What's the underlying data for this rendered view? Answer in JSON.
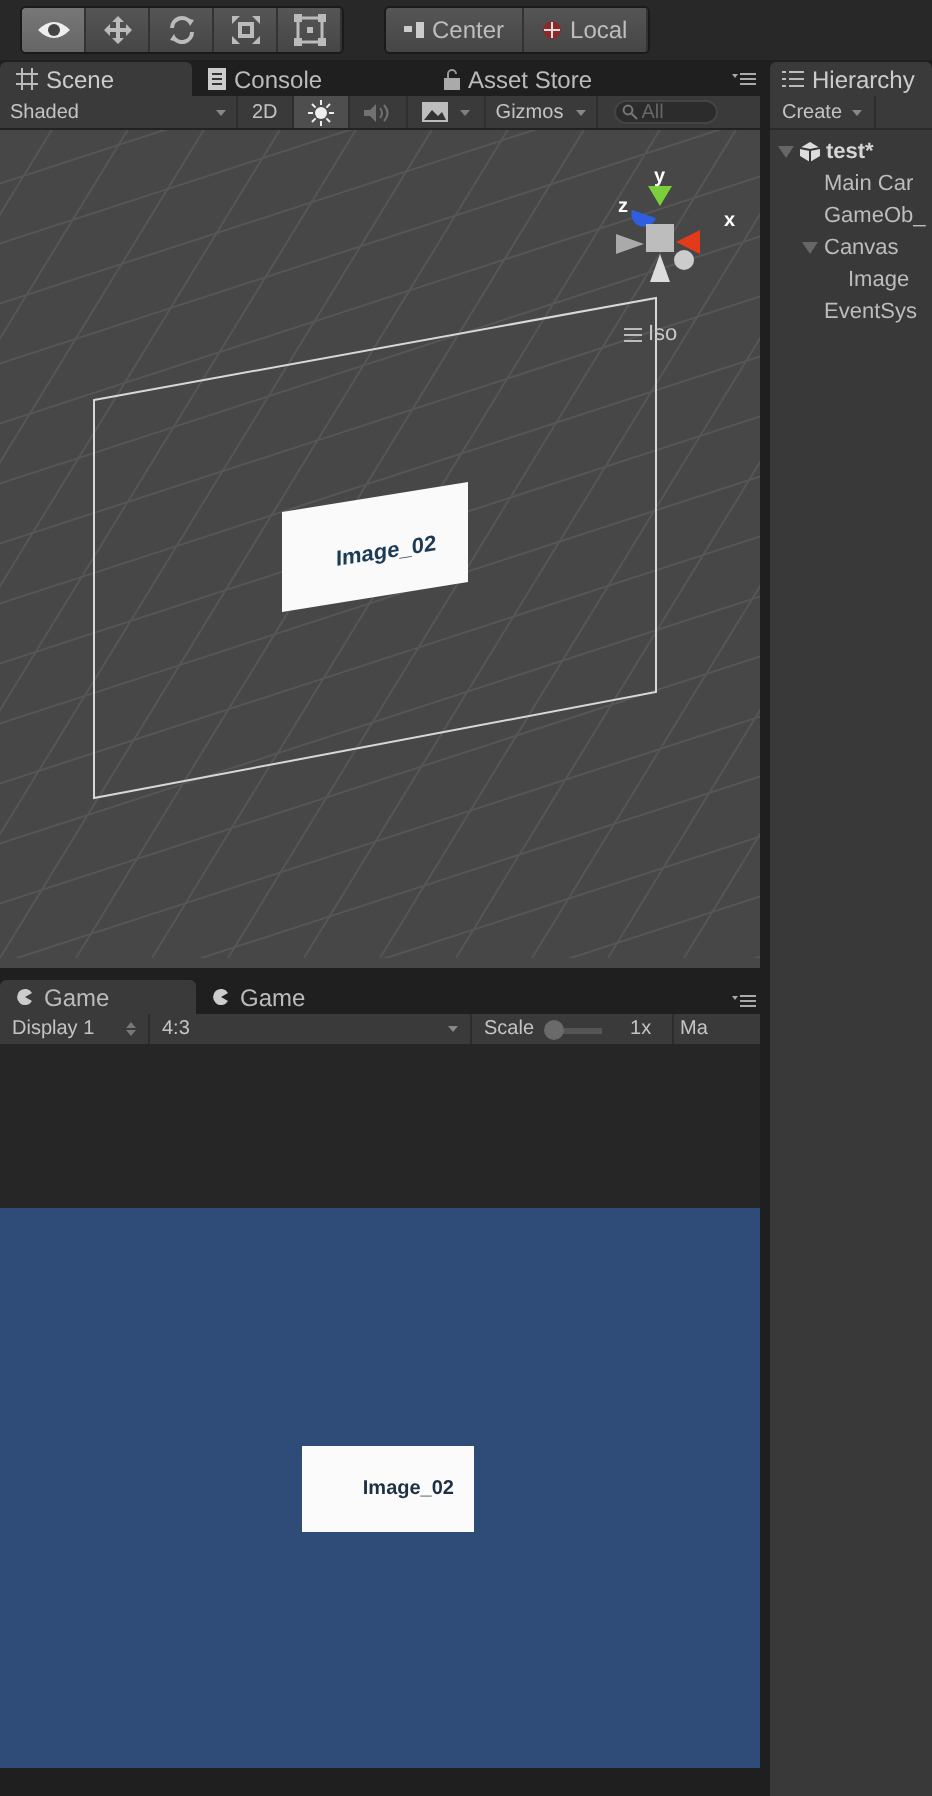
{
  "toolbar": {
    "tools": [
      {
        "kind": "view",
        "selected": true
      },
      {
        "kind": "move",
        "selected": false
      },
      {
        "kind": "rotate",
        "selected": false
      },
      {
        "kind": "scale",
        "selected": false
      },
      {
        "kind": "rect",
        "selected": false
      }
    ],
    "pivot": [
      {
        "kind": "center",
        "label": "Center"
      },
      {
        "kind": "local",
        "label": "Local"
      }
    ]
  },
  "scene_panel": {
    "tabs": [
      {
        "kind": "scene",
        "label": "Scene",
        "selected": true
      },
      {
        "kind": "console",
        "label": "Console",
        "selected": false
      },
      {
        "kind": "store",
        "label": "Asset Store",
        "selected": false
      }
    ],
    "shading": "Shaded",
    "mode_2d": "2D",
    "toggles": [
      {
        "kind": "lighting",
        "on": true
      },
      {
        "kind": "audio",
        "on": false
      },
      {
        "kind": "effects",
        "on": false
      }
    ],
    "gizmos": "Gizmos",
    "search": {
      "placeholder": "All"
    },
    "axes": [
      {
        "kind": "y",
        "label": "y"
      },
      {
        "kind": "z",
        "label": "z"
      },
      {
        "kind": "x",
        "label": "x"
      }
    ],
    "projection": "Iso",
    "object_label": "Image_02"
  },
  "game_panel": {
    "tabs": [
      {
        "label": "Game",
        "selected": true
      },
      {
        "label": "Game",
        "selected": false
      }
    ],
    "display": "Display 1",
    "aspect": "4:3",
    "scale": {
      "label": "Scale",
      "level": 0,
      "reading": "1x"
    },
    "maximize": "Ma",
    "object_label": "Image_02"
  },
  "hierarchy": {
    "title": "Hierarchy",
    "create": "Create",
    "items": [
      {
        "kind": "scene",
        "label": "test*",
        "expanded": true,
        "children": [
          {
            "label": "Main Car"
          },
          {
            "label": "GameOb_"
          },
          {
            "label": "Canvas",
            "expanded": true,
            "children": [
              {
                "label": "Image"
              }
            ]
          },
          {
            "label": "EventSys"
          }
        ]
      }
    ]
  }
}
